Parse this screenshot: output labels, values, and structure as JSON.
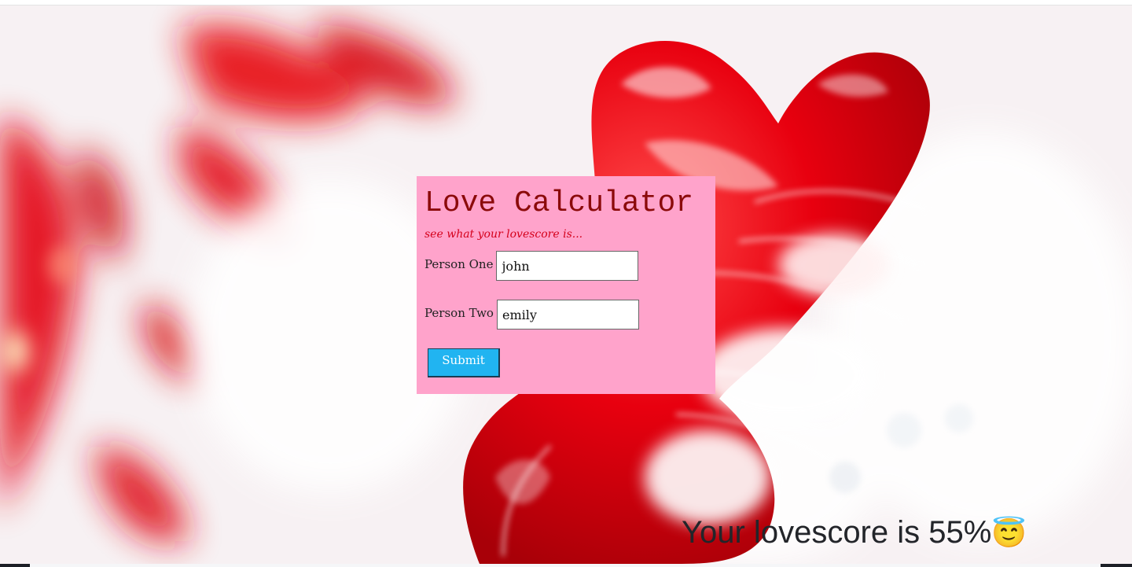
{
  "card": {
    "title": "Love Calculator",
    "subtitle": "see what your lovescore is...",
    "person_one": {
      "label": "Person One",
      "value": "john"
    },
    "person_two": {
      "label": "Person Two",
      "value": "emily"
    },
    "submit_label": "Submit"
  },
  "result": {
    "text": "Your lovescore is 55%",
    "emoji": "😇"
  },
  "colors": {
    "card_background": "#ffa3cb",
    "title": "#8b0a0a",
    "subtitle": "#d4001b",
    "submit_button": "#21b4f1",
    "heart_red": "#e8000f"
  }
}
